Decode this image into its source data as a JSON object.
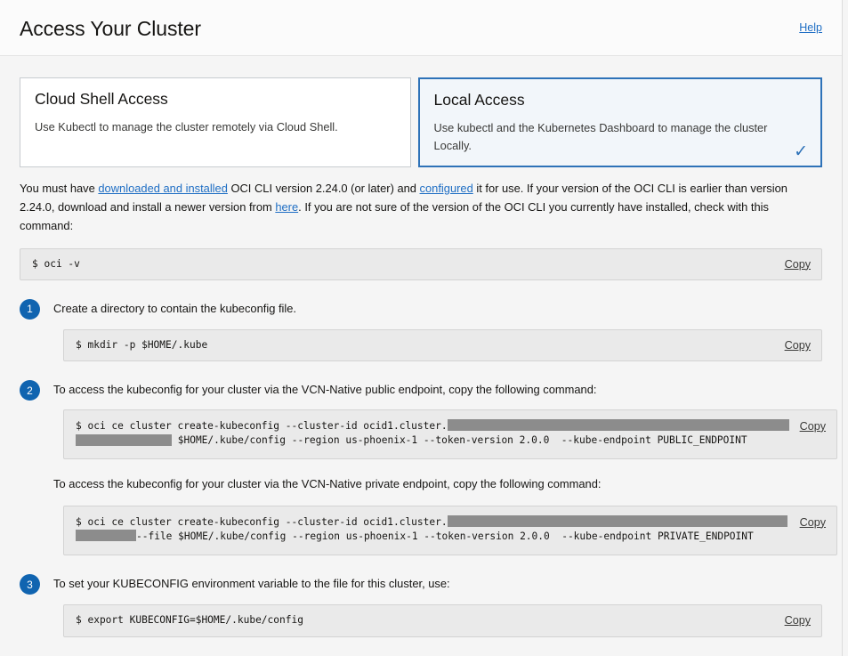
{
  "header": {
    "title": "Access Your Cluster",
    "help_label": "Help"
  },
  "cards": [
    {
      "name": "cloud-shell-access",
      "title": "Cloud Shell Access",
      "description": "Use Kubectl to manage the cluster remotely via Cloud Shell.",
      "selected": false
    },
    {
      "name": "local-access",
      "title": "Local Access",
      "description": "Use kubectl and the Kubernetes Dashboard to manage the cluster Locally.",
      "selected": true,
      "check_glyph": "✓"
    }
  ],
  "intro": {
    "part1": "You must have ",
    "link1": "downloaded and installed",
    "part2": " OCI CLI version 2.24.0 (or later) and ",
    "link2": "configured",
    "part3": " it for use. If your version of the OCI CLI is earlier than version 2.24.0, download and install a newer version from ",
    "link3": "here",
    "part4": ". If you are not sure of the version of the OCI CLI you currently have installed, check with this command:"
  },
  "version_command": {
    "code": "$ oci -v",
    "copy_label": "Copy"
  },
  "steps": [
    {
      "number": "1",
      "text": "Create a directory to contain the kubeconfig file.",
      "code": "$ mkdir -p $HOME/.kube",
      "copy_label": "Copy"
    },
    {
      "number": "2",
      "text": "To access the kubeconfig for your cluster via the VCN-Native public endpoint, copy the following command:",
      "public_code_prefix": "$ oci ce cluster create-kubeconfig --cluster-id ocid1.cluster.",
      "public_code_line2": " $HOME/.kube/config --region us-phoenix-1 --token-version 2.0.0  --kube-endpoint PUBLIC_ENDPOINT",
      "copy_label": "Copy",
      "subtext": "To access the kubeconfig for your cluster via the VCN-Native private endpoint, copy the following command:",
      "private_code_prefix": "$ oci ce cluster create-kubeconfig --cluster-id ocid1.cluster.",
      "private_code_line2": "--file $HOME/.kube/config --region us-phoenix-1 --token-version 2.0.0  --kube-endpoint PRIVATE_ENDPOINT",
      "copy_label2": "Copy"
    },
    {
      "number": "3",
      "text": "To set your KUBECONFIG environment variable to the file for this cluster, use:",
      "code": "$ export KUBECONFIG=$HOME/.kube/config",
      "copy_label": "Copy"
    }
  ],
  "colors": {
    "accent_blue": "#1064b0",
    "link_blue": "#1f6ec4",
    "selected_border": "#2e72b8",
    "redaction_gray": "#8c8c8c",
    "code_bg": "#eaeaea",
    "page_bg": "#f5f5f5"
  }
}
